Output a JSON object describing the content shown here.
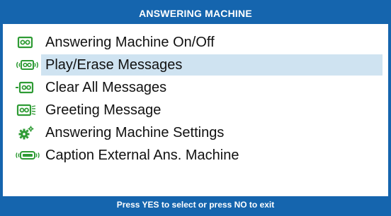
{
  "header": {
    "title": "ANSWERING MACHINE"
  },
  "menu": {
    "selected_index": 1,
    "items": [
      {
        "label": "Answering Machine On/Off",
        "icon": "answering-machine-icon"
      },
      {
        "label": "Play/Erase Messages",
        "icon": "play-messages-icon"
      },
      {
        "label": "Clear All Messages",
        "icon": "clear-messages-icon"
      },
      {
        "label": "Greeting Message",
        "icon": "greeting-message-icon"
      },
      {
        "label": "Answering Machine Settings",
        "icon": "settings-gears-icon"
      },
      {
        "label": "Caption External Ans. Machine",
        "icon": "external-machine-icon"
      }
    ]
  },
  "footer": {
    "hint": "Press YES to select or press NO to exit"
  },
  "colors": {
    "accent": "#1565ae",
    "icon_green": "#2e9b34",
    "selection": "#cfe3f1"
  }
}
